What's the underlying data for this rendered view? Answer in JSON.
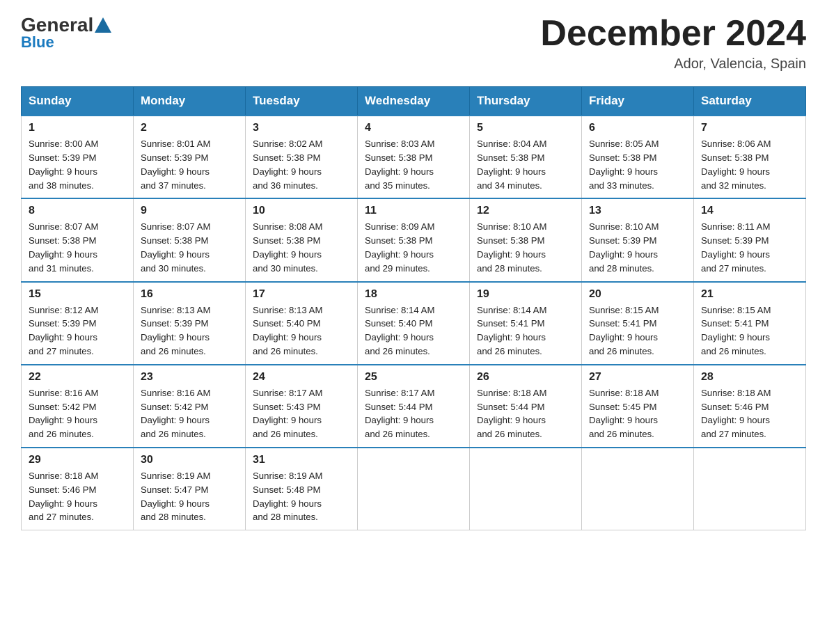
{
  "header": {
    "logo_general": "General",
    "logo_blue": "Blue",
    "month_title": "December 2024",
    "location": "Ador, Valencia, Spain"
  },
  "days_of_week": [
    "Sunday",
    "Monday",
    "Tuesday",
    "Wednesday",
    "Thursday",
    "Friday",
    "Saturday"
  ],
  "weeks": [
    [
      {
        "day": "1",
        "sunrise": "8:00 AM",
        "sunset": "5:39 PM",
        "daylight": "9 hours and 38 minutes."
      },
      {
        "day": "2",
        "sunrise": "8:01 AM",
        "sunset": "5:39 PM",
        "daylight": "9 hours and 37 minutes."
      },
      {
        "day": "3",
        "sunrise": "8:02 AM",
        "sunset": "5:38 PM",
        "daylight": "9 hours and 36 minutes."
      },
      {
        "day": "4",
        "sunrise": "8:03 AM",
        "sunset": "5:38 PM",
        "daylight": "9 hours and 35 minutes."
      },
      {
        "day": "5",
        "sunrise": "8:04 AM",
        "sunset": "5:38 PM",
        "daylight": "9 hours and 34 minutes."
      },
      {
        "day": "6",
        "sunrise": "8:05 AM",
        "sunset": "5:38 PM",
        "daylight": "9 hours and 33 minutes."
      },
      {
        "day": "7",
        "sunrise": "8:06 AM",
        "sunset": "5:38 PM",
        "daylight": "9 hours and 32 minutes."
      }
    ],
    [
      {
        "day": "8",
        "sunrise": "8:07 AM",
        "sunset": "5:38 PM",
        "daylight": "9 hours and 31 minutes."
      },
      {
        "day": "9",
        "sunrise": "8:07 AM",
        "sunset": "5:38 PM",
        "daylight": "9 hours and 30 minutes."
      },
      {
        "day": "10",
        "sunrise": "8:08 AM",
        "sunset": "5:38 PM",
        "daylight": "9 hours and 30 minutes."
      },
      {
        "day": "11",
        "sunrise": "8:09 AM",
        "sunset": "5:38 PM",
        "daylight": "9 hours and 29 minutes."
      },
      {
        "day": "12",
        "sunrise": "8:10 AM",
        "sunset": "5:38 PM",
        "daylight": "9 hours and 28 minutes."
      },
      {
        "day": "13",
        "sunrise": "8:10 AM",
        "sunset": "5:39 PM",
        "daylight": "9 hours and 28 minutes."
      },
      {
        "day": "14",
        "sunrise": "8:11 AM",
        "sunset": "5:39 PM",
        "daylight": "9 hours and 27 minutes."
      }
    ],
    [
      {
        "day": "15",
        "sunrise": "8:12 AM",
        "sunset": "5:39 PM",
        "daylight": "9 hours and 27 minutes."
      },
      {
        "day": "16",
        "sunrise": "8:13 AM",
        "sunset": "5:39 PM",
        "daylight": "9 hours and 26 minutes."
      },
      {
        "day": "17",
        "sunrise": "8:13 AM",
        "sunset": "5:40 PM",
        "daylight": "9 hours and 26 minutes."
      },
      {
        "day": "18",
        "sunrise": "8:14 AM",
        "sunset": "5:40 PM",
        "daylight": "9 hours and 26 minutes."
      },
      {
        "day": "19",
        "sunrise": "8:14 AM",
        "sunset": "5:41 PM",
        "daylight": "9 hours and 26 minutes."
      },
      {
        "day": "20",
        "sunrise": "8:15 AM",
        "sunset": "5:41 PM",
        "daylight": "9 hours and 26 minutes."
      },
      {
        "day": "21",
        "sunrise": "8:15 AM",
        "sunset": "5:41 PM",
        "daylight": "9 hours and 26 minutes."
      }
    ],
    [
      {
        "day": "22",
        "sunrise": "8:16 AM",
        "sunset": "5:42 PM",
        "daylight": "9 hours and 26 minutes."
      },
      {
        "day": "23",
        "sunrise": "8:16 AM",
        "sunset": "5:42 PM",
        "daylight": "9 hours and 26 minutes."
      },
      {
        "day": "24",
        "sunrise": "8:17 AM",
        "sunset": "5:43 PM",
        "daylight": "9 hours and 26 minutes."
      },
      {
        "day": "25",
        "sunrise": "8:17 AM",
        "sunset": "5:44 PM",
        "daylight": "9 hours and 26 minutes."
      },
      {
        "day": "26",
        "sunrise": "8:18 AM",
        "sunset": "5:44 PM",
        "daylight": "9 hours and 26 minutes."
      },
      {
        "day": "27",
        "sunrise": "8:18 AM",
        "sunset": "5:45 PM",
        "daylight": "9 hours and 26 minutes."
      },
      {
        "day": "28",
        "sunrise": "8:18 AM",
        "sunset": "5:46 PM",
        "daylight": "9 hours and 27 minutes."
      }
    ],
    [
      {
        "day": "29",
        "sunrise": "8:18 AM",
        "sunset": "5:46 PM",
        "daylight": "9 hours and 27 minutes."
      },
      {
        "day": "30",
        "sunrise": "8:19 AM",
        "sunset": "5:47 PM",
        "daylight": "9 hours and 28 minutes."
      },
      {
        "day": "31",
        "sunrise": "8:19 AM",
        "sunset": "5:48 PM",
        "daylight": "9 hours and 28 minutes."
      },
      null,
      null,
      null,
      null
    ]
  ],
  "labels": {
    "sunrise": "Sunrise:",
    "sunset": "Sunset:",
    "daylight": "Daylight:"
  }
}
